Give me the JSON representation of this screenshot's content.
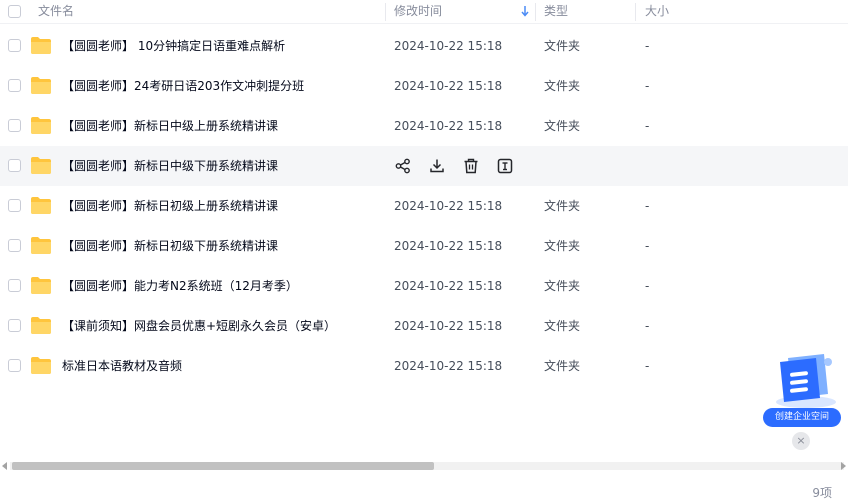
{
  "header": {
    "col_name": "文件名",
    "col_time": "修改时间",
    "col_type": "类型",
    "col_size": "大小"
  },
  "files": [
    {
      "name": "【圆圆老师】 10分钟搞定日语重难点解析",
      "time": "2024-10-22 15:18",
      "type": "文件夹",
      "size": "-"
    },
    {
      "name": "【圆圆老师】24考研日语203作文冲刺提分班",
      "time": "2024-10-22 15:18",
      "type": "文件夹",
      "size": "-"
    },
    {
      "name": "【圆圆老师】新标日中级上册系统精讲课",
      "time": "2024-10-22 15:18",
      "type": "文件夹",
      "size": "-"
    },
    {
      "name": "【圆圆老师】新标日中级下册系统精讲课",
      "time": "",
      "type": "",
      "size": ""
    },
    {
      "name": "【圆圆老师】新标日初级上册系统精讲课",
      "time": "2024-10-22 15:18",
      "type": "文件夹",
      "size": "-"
    },
    {
      "name": "【圆圆老师】新标日初级下册系统精讲课",
      "time": "2024-10-22 15:18",
      "type": "文件夹",
      "size": "-"
    },
    {
      "name": "【圆圆老师】能力考N2系统班（12月考季）",
      "time": "2024-10-22 15:18",
      "type": "文件夹",
      "size": "-"
    },
    {
      "name": "【课前须知】网盘会员优惠+短剧永久会员（安卓）",
      "time": "2024-10-22 15:18",
      "type": "文件夹",
      "size": "-"
    },
    {
      "name": "标准日本语教材及音频",
      "time": "2024-10-22 15:18",
      "type": "文件夹",
      "size": "-"
    }
  ],
  "hover_row_actions": [
    "share-icon",
    "download-icon",
    "delete-icon",
    "rename-icon"
  ],
  "footer": {
    "count": "9项"
  },
  "promo": {
    "label": "创建企业空间",
    "close": "×"
  },
  "colors": {
    "folder": "#ffc53d",
    "accent": "#2c6cff",
    "sort_arrow": "#4b8bf5"
  }
}
